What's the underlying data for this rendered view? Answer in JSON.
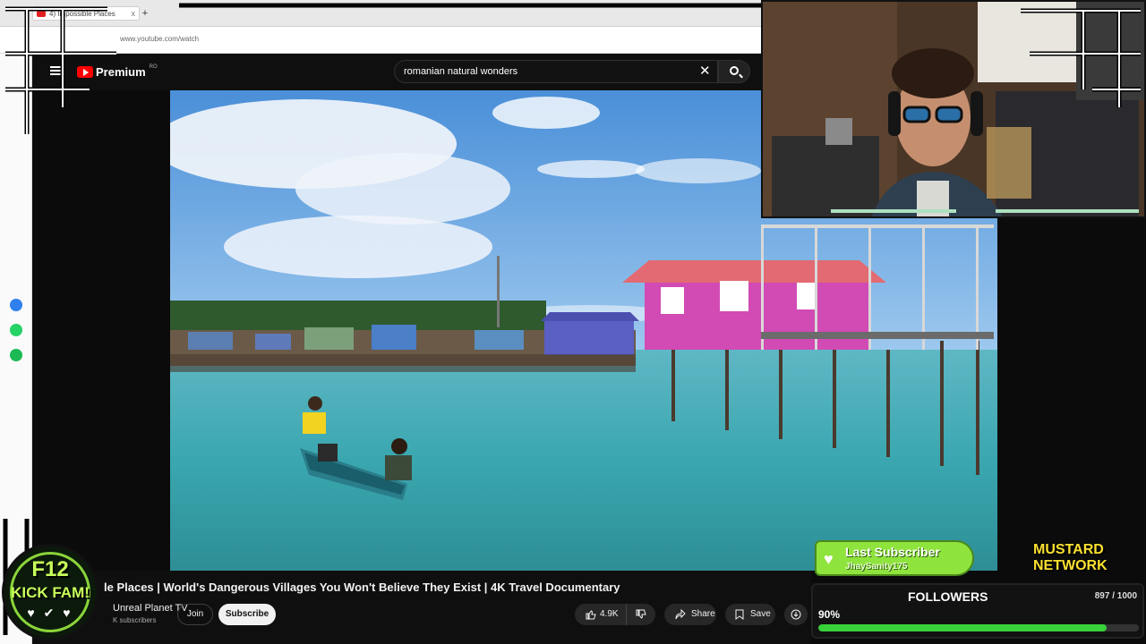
{
  "browser": {
    "tab_title": "4) Impossible Places",
    "tab_close": "x",
    "new_tab": "+",
    "url": "www.youtube.com/watch"
  },
  "youtube": {
    "logo_text": "Premium",
    "region": "RO",
    "search_query": "romanian natural wonders",
    "clear_symbol": "✕"
  },
  "video": {
    "title": "le Places | World's Dangerous Villages You Won't Believe They Exist | 4K Travel Documentary",
    "channel": "Unreal Planet TV",
    "subscribers": "K subscribers",
    "join_label": "Join",
    "subscribe_label": "Subscribe",
    "likes": "4.9K",
    "share_label": "Share",
    "save_label": "Save"
  },
  "overlay": {
    "badge_line1": "F12",
    "badge_line2": "KICK FAM!",
    "badge_hearts": "♥ ✔ ♥",
    "last_subscriber_label": "Last Subscriber",
    "last_subscriber_name": "JhaySanity175",
    "network_line1": "MUSTARD",
    "network_line2": "NETWORK",
    "followers_label": "FOLLOWERS",
    "followers_count": "897 / 1000",
    "followers_percent_label": "90%",
    "followers_progress": 0.9
  },
  "colors": {
    "youtube_red": "#ff0000",
    "accent_green": "#38d13a",
    "mustard": "#fbe030",
    "badge_green": "#c8ff5a"
  },
  "icons": [
    "menu-icon",
    "search-icon",
    "close-icon",
    "like-icon",
    "dislike-icon",
    "share-icon",
    "save-icon",
    "download-icon",
    "heart-icon",
    "messenger-icon",
    "whatsapp-icon",
    "spotify-icon"
  ]
}
